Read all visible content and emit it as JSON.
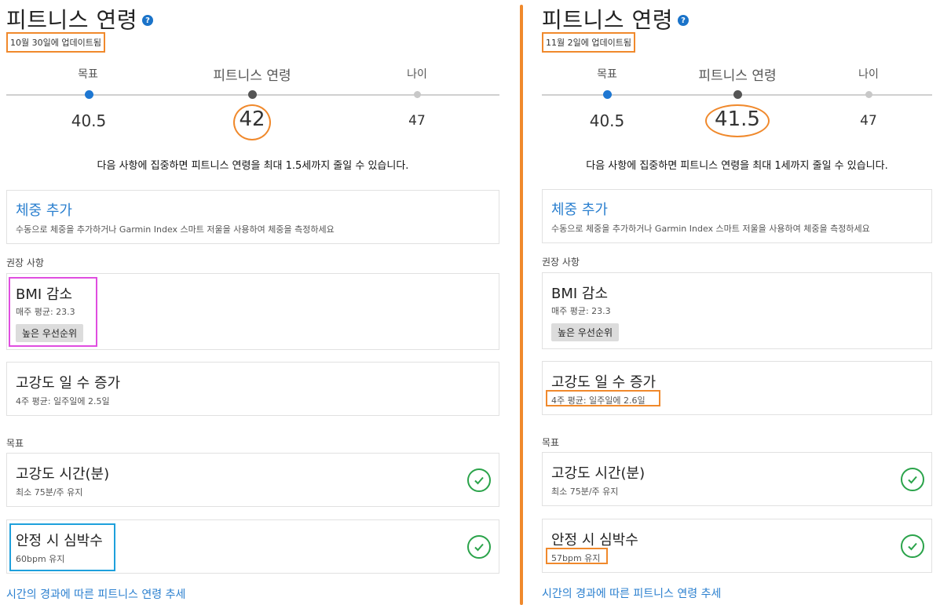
{
  "accent_orange": "#f0892c",
  "link_blue": "#2a7fcf",
  "goal_blue": "#1e77d2",
  "check_green": "#2aa34a",
  "left": {
    "title": "피트니스 연령",
    "help_icon": "question-circle-icon",
    "updated": "10월 30일에 업데이트됨",
    "labels": {
      "goal": "목표",
      "fitness_age": "피트니스 연령",
      "age": "나이"
    },
    "values": {
      "goal": "40.5",
      "fitness_age": "42",
      "age": "47"
    },
    "focus_message": "다음 사항에 집중하면 피트니스 연령을 최대 1.5세까지 줄일 수 있습니다.",
    "weight_card": {
      "title": "체중 추가",
      "subtitle": "수동으로 체중을 추가하거나 Garmin Index 스마트 저울을 사용하여 체중을 측정하세요"
    },
    "recommendations_label": "권장 사항",
    "bmi_card": {
      "title": "BMI 감소",
      "subtitle": "매주 평균: 23.3",
      "tag": "높은 우선순위"
    },
    "vigorous_days_card": {
      "title": "고강도 일 수 증가",
      "subtitle": "4주 평균: 일주일에 2.5일"
    },
    "goals_label": "목표",
    "vigorous_minutes_card": {
      "title": "고강도 시간(분)",
      "subtitle": "최소 75분/주 유지"
    },
    "resting_hr_card": {
      "title": "안정 시 심박수",
      "subtitle": "60bpm 유지"
    },
    "trend_link": "시간의 경과에 따른 피트니스 연령 추세"
  },
  "right": {
    "title": "피트니스 연령",
    "help_icon": "question-circle-icon",
    "updated": "11월 2일에 업데이트됨",
    "labels": {
      "goal": "목표",
      "fitness_age": "피트니스 연령",
      "age": "나이"
    },
    "values": {
      "goal": "40.5",
      "fitness_age": "41.5",
      "age": "47"
    },
    "focus_message": "다음 사항에 집중하면 피트니스 연령을 최대 1세까지 줄일 수 있습니다.",
    "weight_card": {
      "title": "체중 추가",
      "subtitle": "수동으로 체중을 추가하거나 Garmin Index 스마트 저울을 사용하여 체중을 측정하세요"
    },
    "recommendations_label": "권장 사항",
    "bmi_card": {
      "title": "BMI 감소",
      "subtitle": "매주 평균: 23.3",
      "tag": "높은 우선순위"
    },
    "vigorous_days_card": {
      "title": "고강도 일 수 증가",
      "subtitle": "4주 평균: 일주일에 2.6일"
    },
    "goals_label": "목표",
    "vigorous_minutes_card": {
      "title": "고강도 시간(분)",
      "subtitle": "최소 75분/주 유지"
    },
    "resting_hr_card": {
      "title": "안정 시 심박수",
      "subtitle": "57bpm 유지"
    },
    "trend_link": "시간의 경과에 따른 피트니스 연령 추세"
  }
}
